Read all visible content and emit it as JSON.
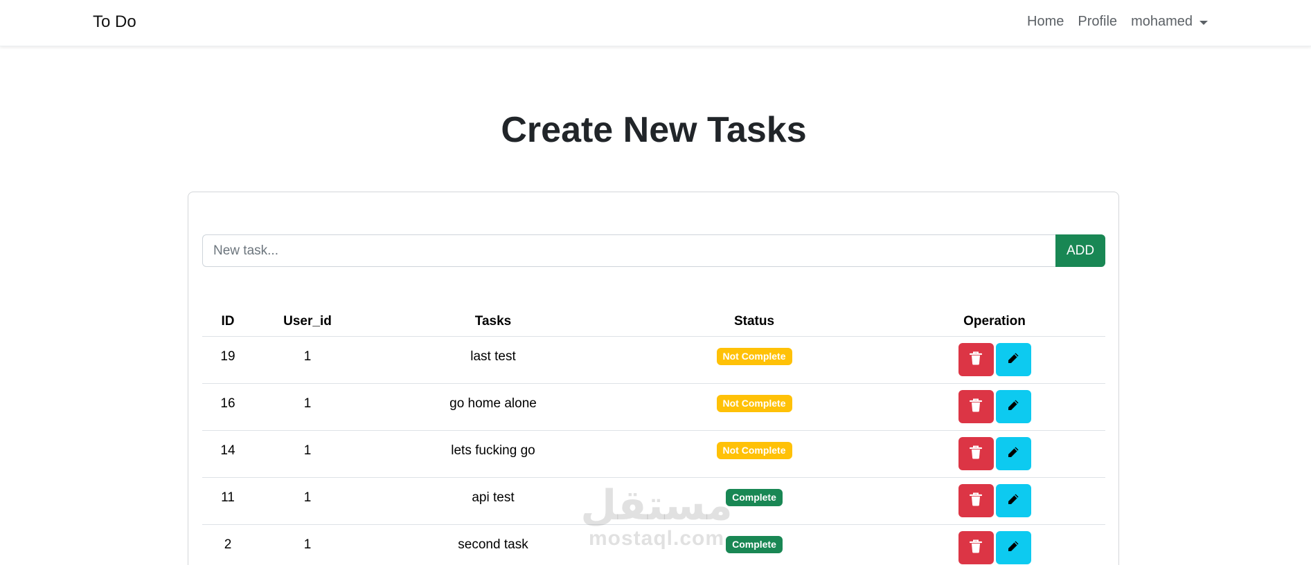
{
  "nav": {
    "brand": "To Do",
    "links": [
      "Home",
      "Profile"
    ],
    "user": "mohamed"
  },
  "page_title": "Create New Tasks",
  "form": {
    "placeholder": "New task...",
    "value": "",
    "add_label": "ADD"
  },
  "table": {
    "headers": [
      "ID",
      "User_id",
      "Tasks",
      "Status",
      "Operation"
    ],
    "rows": [
      {
        "id": "19",
        "user_id": "1",
        "task": "last test",
        "status": "Not Complete"
      },
      {
        "id": "16",
        "user_id": "1",
        "task": "go home alone",
        "status": "Not Complete"
      },
      {
        "id": "14",
        "user_id": "1",
        "task": "lets fucking go",
        "status": "Not Complete"
      },
      {
        "id": "11",
        "user_id": "1",
        "task": "api test",
        "status": "Complete"
      },
      {
        "id": "2",
        "user_id": "1",
        "task": "second task",
        "status": "Complete"
      }
    ]
  },
  "icons": {
    "delete": "trash-icon",
    "edit": "pencil-icon"
  },
  "colors": {
    "add_button": "#198754",
    "not_complete_badge": "#ffc107",
    "complete_badge": "#198754",
    "delete_button": "#dc3545",
    "edit_button": "#0dcaf0"
  },
  "watermark": {
    "logo": "مستقل",
    "text": "mostaql.com"
  }
}
